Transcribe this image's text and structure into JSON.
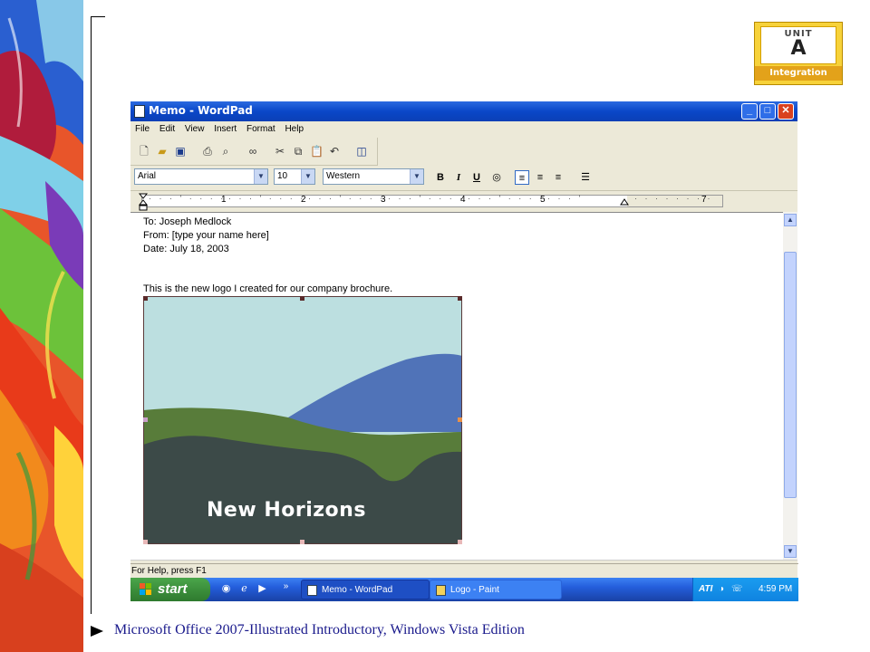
{
  "unit_badge": {
    "unit_word": "UNIT",
    "letter": "A",
    "subject": "Integration"
  },
  "window": {
    "title": "Memo - WordPad",
    "minimize": "_",
    "maximize": "□",
    "close": "✕"
  },
  "menu": [
    "File",
    "Edit",
    "View",
    "Insert",
    "Format",
    "Help"
  ],
  "format_bar": {
    "font": "Arial",
    "size": "10",
    "script": "Western",
    "bold": "B",
    "italic": "I",
    "underline": "U"
  },
  "ruler_numbers": [
    "1",
    "2",
    "3",
    "4",
    "5",
    "7"
  ],
  "document": {
    "to": "To: Joseph Medlock",
    "from": "From: [type your name here]",
    "date": "Date: July 18, 2003",
    "body": "This is the new logo I created for our company brochure.",
    "logo_text": "New Horizons"
  },
  "status": "For Help, press F1",
  "taskbar": {
    "start": "start",
    "overflow": "»",
    "tasks": [
      "Memo - WordPad",
      "Logo - Paint"
    ],
    "clock": "4:59 PM"
  },
  "footer": "Microsoft Office 2007-Illustrated Introductory, Windows Vista Edition",
  "colors": {
    "sky": "#bcdfe0",
    "hill_blue": "#5073b8",
    "hill_green": "#587c3a",
    "hill_dark": "#3c4a48",
    "titlebar": "#0a47c8",
    "taskbar": "#245edb",
    "start_green": "#3c8f3c"
  }
}
